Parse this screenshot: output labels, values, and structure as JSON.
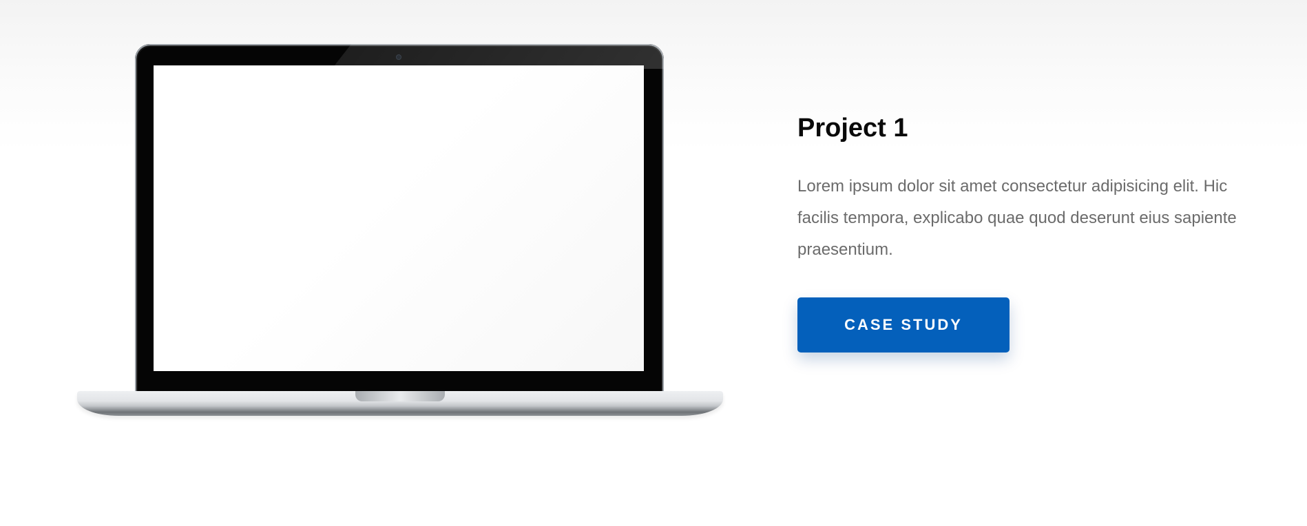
{
  "project": {
    "title": "Project 1",
    "description": "Lorem ipsum dolor sit amet consectetur adipisicing elit. Hic facilis tempora, explicabo quae quod deserunt eius sapiente praesentium.",
    "cta_label": "CASE STUDY"
  },
  "colors": {
    "accent": "#0460bb",
    "title": "#0a0a0a",
    "body_text": "#6b6b6b"
  },
  "icons": {
    "device": "laptop-mockup-icon"
  }
}
